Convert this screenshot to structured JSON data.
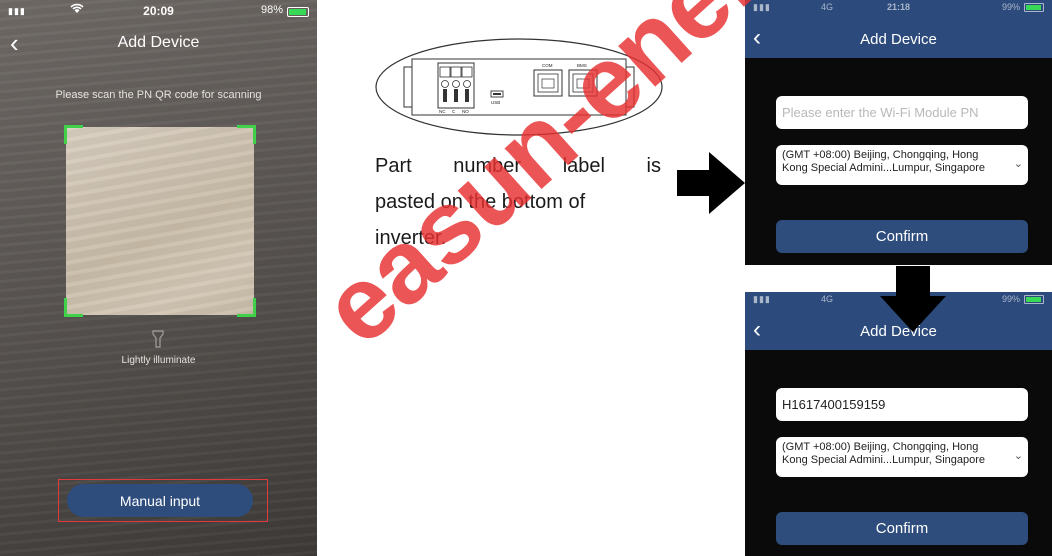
{
  "phone_scan": {
    "status_time": "20:09",
    "battery": "98%",
    "title": "Add Device",
    "hint": "Please scan the PN QR code for scanning",
    "torch_label": "Lightly illuminate",
    "manual_button": "Manual input"
  },
  "device_diagram": {
    "ports": [
      "NC",
      "C",
      "NO",
      "USB",
      "COM",
      "BMS"
    ]
  },
  "description": {
    "line1": "Part number label is",
    "line2": "pasted on the bottom of",
    "line3": "inverter."
  },
  "phone_empty": {
    "status_network": "4G",
    "status_time": "21:18",
    "battery": "99%",
    "title": "Add Device",
    "pn_placeholder": "Please enter the Wi-Fi Module PN",
    "timezone_line1": "(GMT +08:00) Beijing, Chongqing, Hong",
    "timezone_line2": "Kong Special Admini...Lumpur, Singapore",
    "confirm": "Confirm"
  },
  "phone_filled": {
    "status_network": "4G",
    "battery": "99%",
    "title": "Add Device",
    "pn_value": "H1617400159159",
    "timezone_line1": "(GMT +08:00) Beijing, Chongqing, Hong",
    "timezone_line2": "Kong Special Admini...Lumpur, Singapore",
    "confirm": "Confirm"
  },
  "watermark": "easun-energy.com",
  "colors": {
    "brand_blue": "#2c4b7c",
    "scan_green": "#3fd14a",
    "highlight_red": "#e23a3a",
    "watermark_red": "#e83030"
  }
}
